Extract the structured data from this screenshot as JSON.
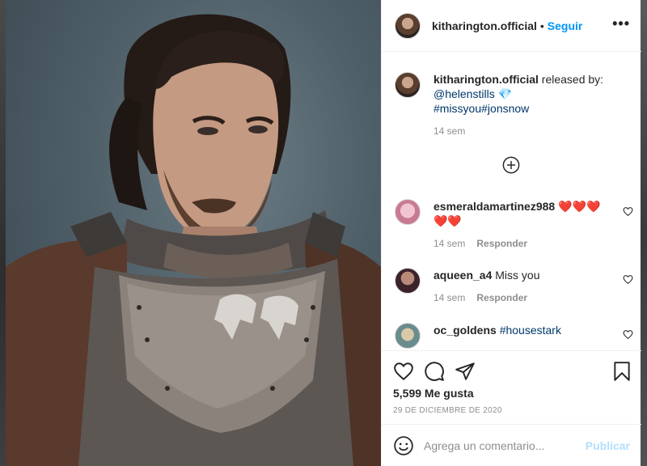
{
  "post": {
    "username": "kitharington.official",
    "follow_label": "Seguir",
    "dot": "•",
    "more_label": "•••"
  },
  "caption": {
    "username": "kitharington.official",
    "text": " released by:",
    "mention": "@helenstills",
    "emoji": "💎",
    "hashtags": "#missyou#jonsnow",
    "time": "14 sem"
  },
  "comments": [
    {
      "username": "esmeraldamartinez988",
      "text": " ❤️❤️❤️❤️❤️",
      "time": "14 sem",
      "reply": "Responder"
    },
    {
      "username": "aqueen_a4",
      "text": " Miss you",
      "time": "14 sem",
      "reply": "Responder"
    },
    {
      "username": "oc_goldens",
      "hashtag": "#housestark"
    }
  ],
  "stats": {
    "likes": "5,599 Me gusta",
    "date": "29 DE DICIEMBRE DE 2020"
  },
  "composer": {
    "placeholder": "Agrega un comentario...",
    "publish_label": "Publicar"
  },
  "icons": {
    "more": "more-icon",
    "load_more": "plus-circle-icon",
    "like": "heart-icon",
    "comment": "comment-icon",
    "share": "paper-plane-icon",
    "save": "bookmark-icon",
    "emoji": "smiley-icon"
  },
  "colors": {
    "accent": "#0095f6",
    "link": "#00376b",
    "muted": "#8e8e8e",
    "publish_disabled": "#b2dffc"
  }
}
